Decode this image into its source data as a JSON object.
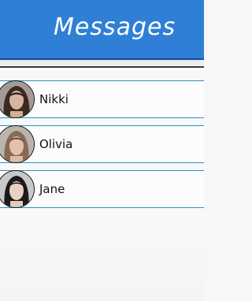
{
  "header": {
    "title": "Messages"
  },
  "contacts": [
    {
      "name": "Nikki"
    },
    {
      "name": "Olivia"
    },
    {
      "name": "Jane"
    }
  ],
  "colors": {
    "header_bg": "#2f7fd6",
    "row_border": "#2b92c4"
  }
}
